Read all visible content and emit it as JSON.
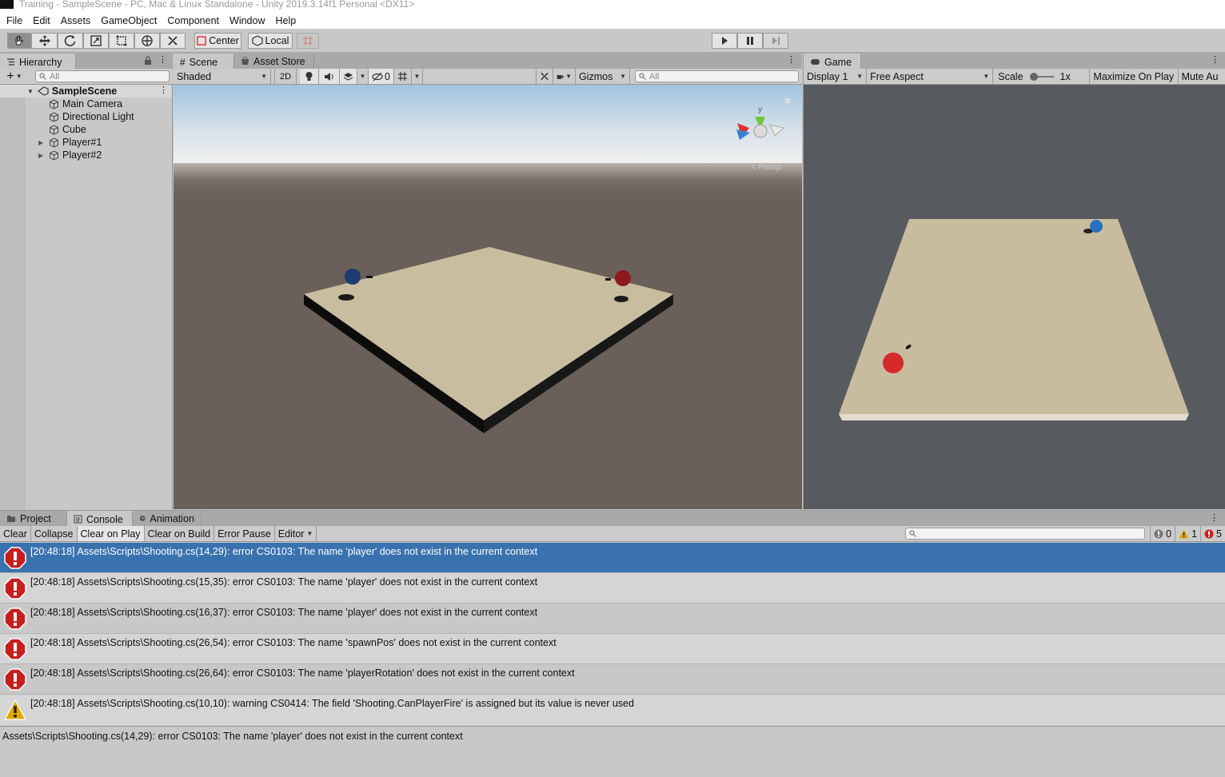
{
  "window": {
    "title": "Training - SampleScene - PC, Mac & Linux Standalone - Unity 2019.3.14f1 Personal <DX11>"
  },
  "menu": [
    "File",
    "Edit",
    "Assets",
    "GameObject",
    "Component",
    "Window",
    "Help"
  ],
  "toolbar": {
    "pivot_label": "Center",
    "space_label": "Local"
  },
  "hierarchy": {
    "tab_label": "Hierarchy",
    "search_placeholder": "All",
    "scene_name": "SampleScene",
    "items": [
      {
        "label": "Main Camera",
        "expandable": false
      },
      {
        "label": "Directional Light",
        "expandable": false
      },
      {
        "label": "Cube",
        "expandable": false
      },
      {
        "label": "Player#1",
        "expandable": true
      },
      {
        "label": "Player#2",
        "expandable": true
      }
    ]
  },
  "scene_view": {
    "tabs": [
      "Scene",
      "Asset Store"
    ],
    "draw_mode": "Shaded",
    "mode_2d": "2D",
    "hidden_count": "0",
    "gizmos_label": "Gizmos",
    "search_placeholder": "All",
    "gizmo_axis_label": "y",
    "projection_label": "Persp",
    "colors": {
      "sky_top": "#9fc4e0",
      "ground": "#6a6059",
      "plane": "#c9bd9f",
      "player1": "#1c3c70",
      "player2": "#8e1b1b"
    }
  },
  "game_view": {
    "tab_label": "Game",
    "display": "Display 1",
    "aspect": "Free Aspect",
    "scale_label": "Scale",
    "scale_value": "1x",
    "maximize_label": "Maximize On Play",
    "mute_label": "Mute Au",
    "colors": {
      "background": "#575a5f",
      "plane": "#c8bc9e",
      "blue_ball": "#2a6fbf",
      "red_ball": "#d42a2a"
    }
  },
  "bottom_tabs": [
    "Project",
    "Console",
    "Animation"
  ],
  "console": {
    "buttons": [
      "Clear",
      "Collapse",
      "Clear on Play",
      "Clear on Build",
      "Error Pause"
    ],
    "editor_dropdown": "Editor",
    "counts": {
      "info": "0",
      "warning": "1",
      "error": "5"
    },
    "entries": [
      {
        "type": "error",
        "text": "[20:48:18] Assets\\Scripts\\Shooting.cs(14,29): error CS0103: The name 'player' does not exist in the current context",
        "selected": true
      },
      {
        "type": "error",
        "text": "[20:48:18] Assets\\Scripts\\Shooting.cs(15,35): error CS0103: The name 'player' does not exist in the current context",
        "selected": false
      },
      {
        "type": "error",
        "text": "[20:48:18] Assets\\Scripts\\Shooting.cs(16,37): error CS0103: The name 'player' does not exist in the current context",
        "selected": false
      },
      {
        "type": "error",
        "text": "[20:48:18] Assets\\Scripts\\Shooting.cs(26,54): error CS0103: The name 'spawnPos' does not exist in the current context",
        "selected": false
      },
      {
        "type": "error",
        "text": "[20:48:18] Assets\\Scripts\\Shooting.cs(26,64): error CS0103: The name 'playerRotation' does not exist in the current context",
        "selected": false
      },
      {
        "type": "warning",
        "text": "[20:48:18] Assets\\Scripts\\Shooting.cs(10,10): warning CS0414: The field 'Shooting.CanPlayerFire' is assigned but its value is never used",
        "selected": false
      }
    ],
    "detail": "Assets\\Scripts\\Shooting.cs(14,29): error CS0103: The name 'player' does not exist in the current context",
    "colors": {
      "selected": "#3a72b0",
      "error": "#c81e1e",
      "warning": "#e0a800"
    }
  }
}
